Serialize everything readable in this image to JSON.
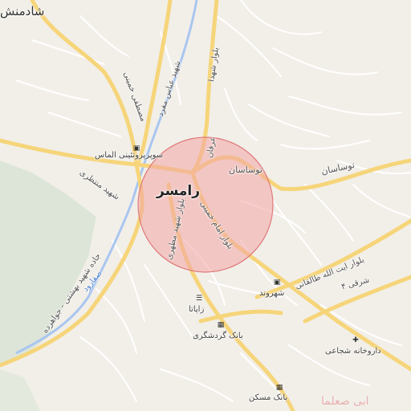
{
  "map": {
    "city_name": "رامسر",
    "places": {
      "top_left_city": "شادمنش",
      "tousasan_1": "توساسان",
      "tousasan_2": "توساسان"
    },
    "roads": {
      "abbas_mofrad": "شهید عباس مفرد",
      "mostafa_khomeini": "مصطفی خمینی",
      "shahid_montazeri": "شهید منتظری",
      "jadeh_beheshti": "جاده شهید بهشتی - جواهرده",
      "shahid_motahari": "بلوار شهید مطهری",
      "emam_khomeini": "بلوار امام خمینی",
      "ayatollah_taleghani": "بلوار ایت الله طالقانی",
      "bolvar_shohada": "بلوار شهدا",
      "sharghi_4": "شرقی ۴",
      "erfan": "عرفان"
    },
    "water": {
      "safarud": "صفارود"
    },
    "pois": {
      "almas_market": "سوپرپروتئینی الماس",
      "shahrvand": "شهروند",
      "zapata": "زاپاتا",
      "bank_gardeshgari": "بانک گردشگری",
      "shojaei_pharmacy": "داروخانه شجاعی",
      "bank_maskan": "بانک مسکن",
      "watermark": "ابی صعلما"
    },
    "icons": {
      "cart": "shopping-cart-icon",
      "restaurant": "restaurant-icon",
      "bank": "bank-icon",
      "pharmacy": "pharmacy-icon"
    },
    "colors": {
      "background": "#f2efe9",
      "road_major": "#f6d57a",
      "road_minor": "#ffffff",
      "river": "#a9c6f0",
      "forest": "#dde5d8",
      "highlight_fill": "#f2a4a4",
      "highlight_stroke": "#e07a7a"
    }
  }
}
